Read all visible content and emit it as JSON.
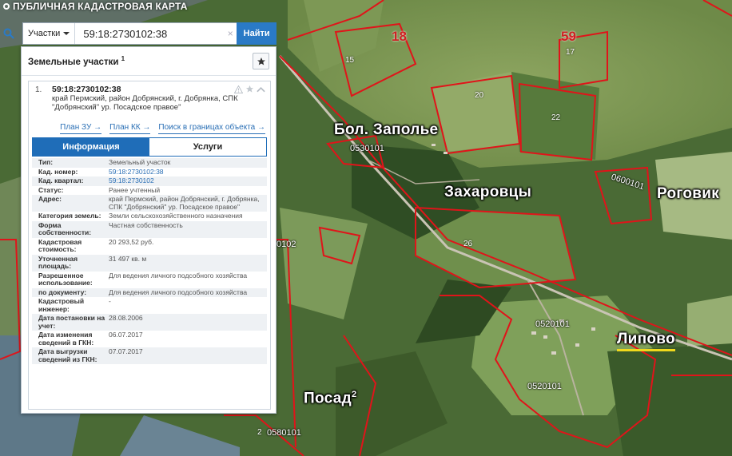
{
  "app": {
    "title": "ПУБЛИЧНАЯ КАДАСТРОВАЯ КАРТА"
  },
  "search": {
    "type_label": "Участки",
    "query": "59:18:2730102:38",
    "clear": "×",
    "button": "Найти"
  },
  "panel": {
    "title": "Земельные участки",
    "count": "1",
    "item": {
      "index": "1.",
      "cadastral_number": "59:18:2730102:38",
      "address_short": "край Пермский, район Добрянский, г. Добрянка, СПК \"Добрянский\" ур. Посадское правое\"",
      "links": [
        "План ЗУ →",
        "План КК →",
        "Поиск в границах объекта →"
      ],
      "tabs": {
        "info": "Информация",
        "services": "Услуги"
      },
      "properties": [
        {
          "key": "Тип:",
          "value": "Земельный участок",
          "link": false
        },
        {
          "key": "Кад. номер:",
          "value": "59:18:2730102:38",
          "link": true
        },
        {
          "key": "Кад. квартал:",
          "value": "59:18:2730102",
          "link": true
        },
        {
          "key": "Статус:",
          "value": "Ранее учтенный",
          "link": false
        },
        {
          "key": "Адрес:",
          "value": "край Пермский, район Добрянский, г. Добрянка, СПК \"Добрянский\" ур. Посадское правое\"",
          "link": false
        },
        {
          "key": "Категория земель:",
          "value": "Земли сельскохозяйственного назначения",
          "link": false
        },
        {
          "key": "Форма собственности:",
          "value": "Частная собственность",
          "link": false
        },
        {
          "key": "Кадастровая стоимость:",
          "value": "20 293,52 руб.",
          "link": false
        },
        {
          "key": "Уточненная площадь:",
          "value": "31 497 кв. м",
          "link": false
        },
        {
          "key": "Разрешенное использование:",
          "value": "Для ведения личного подсобного хозяйства",
          "link": false
        },
        {
          "key": "по документу:",
          "value": "Для ведения личного подсобного хозяйства",
          "link": false
        },
        {
          "key": "Кадастровый инженер:",
          "value": "-",
          "link": false
        },
        {
          "key": "Дата постановки на учет:",
          "value": "28.08.2006",
          "link": false
        },
        {
          "key": "Дата изменения сведений в ГКН:",
          "value": "06.07.2017",
          "link": false
        },
        {
          "key": "Дата выгрузки сведений из ГКН:",
          "value": "07.07.2017",
          "link": false
        }
      ]
    }
  },
  "map": {
    "places": [
      {
        "name": "Бол. Заполье"
      },
      {
        "name": "Захаровцы"
      },
      {
        "name": "Роговик"
      },
      {
        "name": "Липово"
      },
      {
        "name": "Посад",
        "sup": "2"
      }
    ],
    "quarter_numbers": [
      "18",
      "59"
    ],
    "parcel_numbers": [
      "15",
      "17",
      "20",
      "22",
      "26",
      "2"
    ],
    "blocks": [
      "0530101",
      "0600101",
      "0520101",
      "0520101",
      "0580101",
      "0102"
    ]
  },
  "colors": {
    "boundary": "#e0141a",
    "accent": "#1f6db8",
    "highlight": "#f0d81c"
  }
}
